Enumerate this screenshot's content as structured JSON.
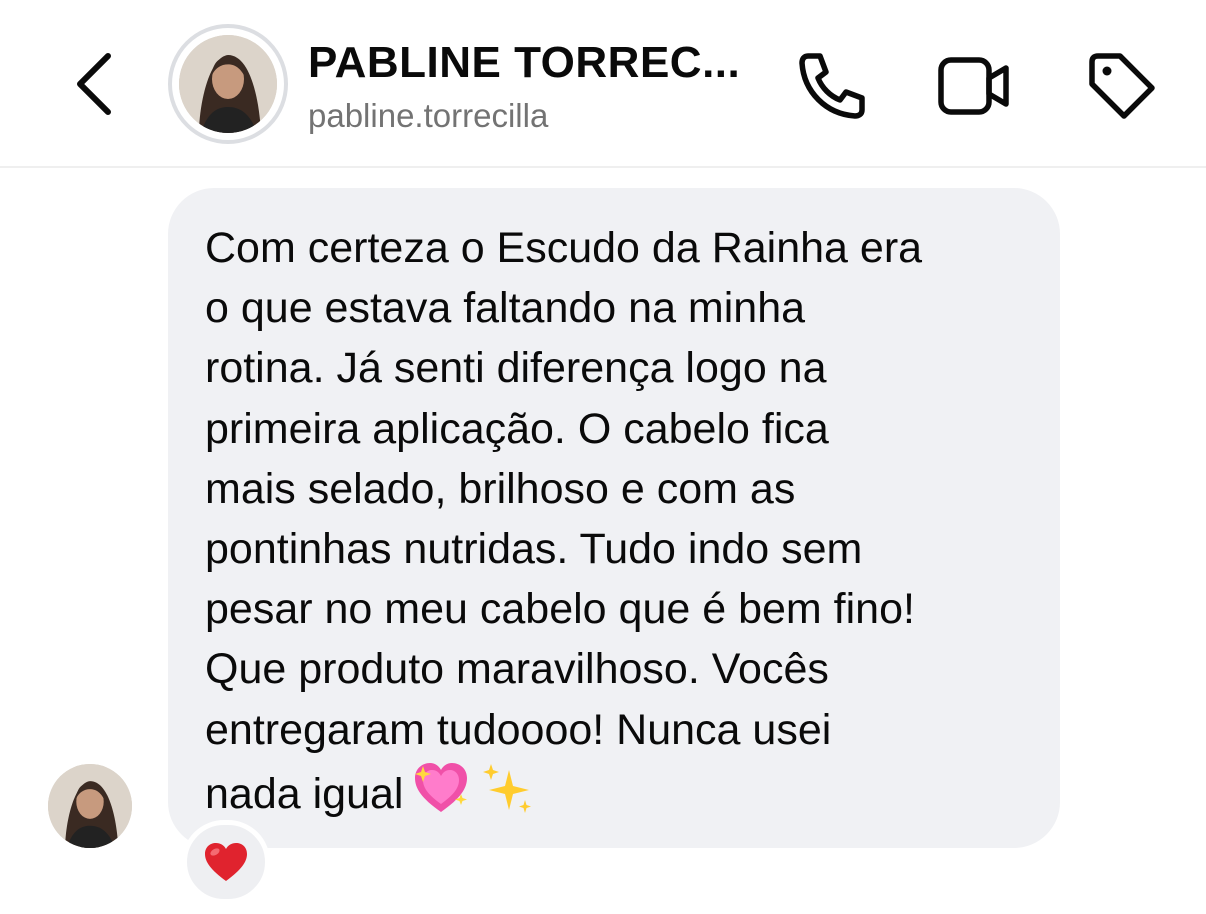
{
  "header": {
    "title": "PABLINE TORREC...",
    "username": "pabline.torrecilla"
  },
  "icons": {
    "back": "chevron-left-icon",
    "call": "phone-icon",
    "video": "video-camera-icon",
    "tag": "tag-icon",
    "reaction": "red-heart-emoji",
    "emoji1": "sparkling-heart-emoji",
    "emoji2": "sparkles-emoji"
  },
  "message": {
    "lines": [
      "Com certeza o Escudo da Rainha era",
      "o que estava faltando na minha",
      "rotina. Já senti diferença logo na",
      "primeira aplicação. O cabelo fica",
      "mais selado, brilhoso e com as",
      "pontinhas nutridas. Tudo indo sem",
      "pesar no meu cabelo que é bem fino!",
      "Que produto maravilhoso. Vocês",
      "entregaram tudoooo! Nunca usei",
      "nada igual"
    ],
    "reaction": "❤️"
  },
  "colors": {
    "bubble": "#f0f1f4",
    "text": "#0a0a0a",
    "secondary_text": "#737373",
    "reaction_heart": "#e0232e"
  }
}
